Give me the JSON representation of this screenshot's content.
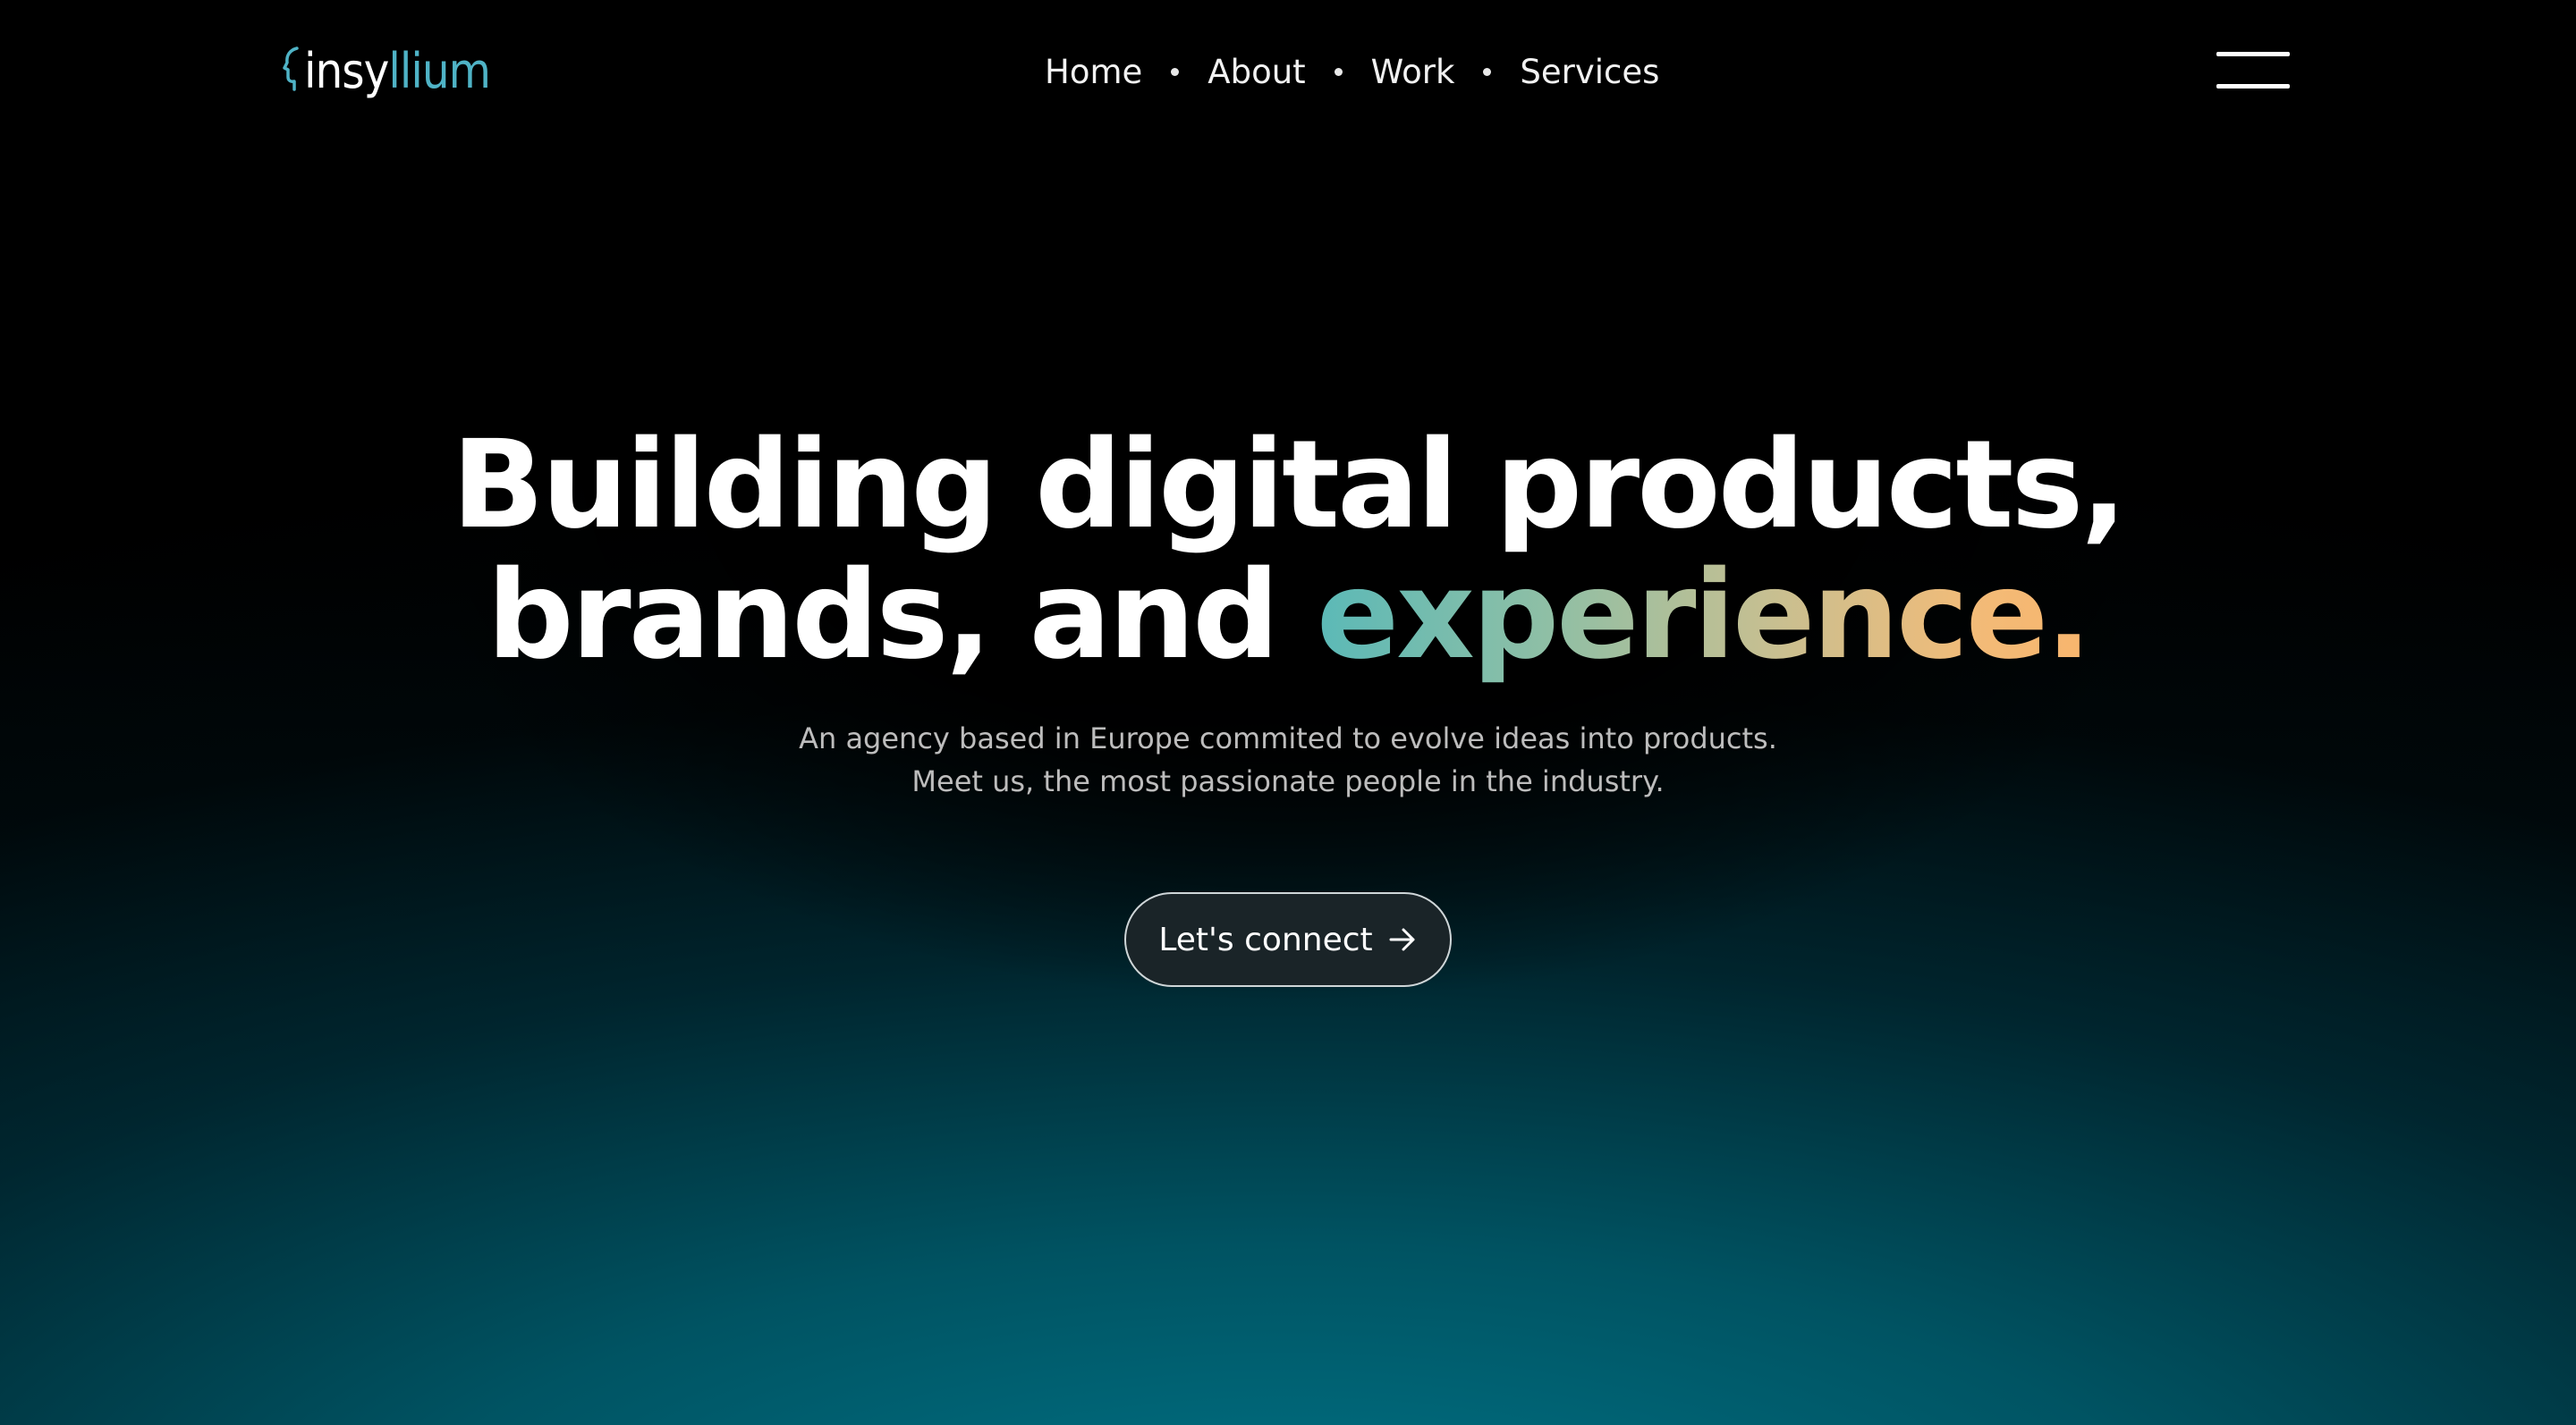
{
  "brand": {
    "name_part1": "insy",
    "name_part2": "llium",
    "logo_icon": "head-profile-icon",
    "accent_color": "#4fb3c6"
  },
  "nav": {
    "items": [
      {
        "label": "Home"
      },
      {
        "label": "About"
      },
      {
        "label": "Work"
      },
      {
        "label": "Services"
      }
    ],
    "menu_icon": "hamburger-menu-icon"
  },
  "hero": {
    "headline_line1": "Building digital products,",
    "headline_line2_plain": "brands, and ",
    "headline_line2_highlight": "experience.",
    "subtitle_line1": "An agency based in Europe commited to evolve ideas into products.",
    "subtitle_line2": "Meet us, the most passionate people in the industry.",
    "cta_label": "Let's connect",
    "cta_icon": "arrow-right-icon"
  },
  "colors": {
    "background": "#000000",
    "glow": "#007a8c",
    "gradient_start": "#5bb9b7",
    "gradient_end": "#f8b56d"
  }
}
